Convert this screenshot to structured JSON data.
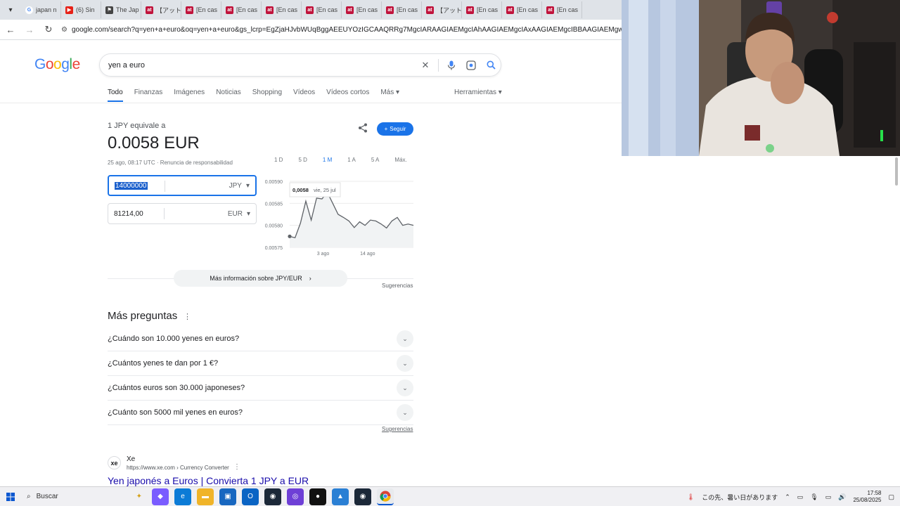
{
  "browser": {
    "tabs": [
      {
        "label": "japan n",
        "icon": "google-icon"
      },
      {
        "label": "(6) Sin",
        "icon": "youtube-icon"
      },
      {
        "label": "The Jap",
        "icon": "site-icon"
      },
      {
        "label": "【アット",
        "icon": "at-icon"
      },
      {
        "label": "[En cas",
        "icon": "at-icon"
      },
      {
        "label": "[En cas",
        "icon": "at-icon"
      },
      {
        "label": "[En cas",
        "icon": "at-icon"
      },
      {
        "label": "[En cas",
        "icon": "at-icon"
      },
      {
        "label": "[En cas",
        "icon": "at-icon"
      },
      {
        "label": "[En cas",
        "icon": "at-icon"
      },
      {
        "label": "【アット",
        "icon": "at-icon"
      },
      {
        "label": "[En cas",
        "icon": "at-icon"
      },
      {
        "label": "[En cas",
        "icon": "at-icon"
      },
      {
        "label": "[En cas",
        "icon": "at-icon"
      }
    ],
    "url": "google.com/search?q=yen+a+euro&oq=yen+a+euro&gs_lcrp=EgZjaHJvbWUqBggAEEUYOzIGCAAQRRg7MgcIARAAGIAEMgcIAhAAGIAEMgcIAxAAGIAEMgcIBBAAGIAEMgwIBRAAGBQYhwI"
  },
  "google": {
    "logo": "Google",
    "query": "yen a euro",
    "tabs": [
      "Todo",
      "Finanzas",
      "Imágenes",
      "Noticias",
      "Shopping",
      "Vídeos",
      "Vídeos cortos",
      "Más"
    ],
    "tools": "Herramientas"
  },
  "converter": {
    "label": "1 JPY equivale a",
    "value": "0.0058 EUR",
    "date": "25 ago, 08:17 UTC · Renuncia de responsabilidad",
    "follow": "Seguir",
    "ranges": [
      "1 D",
      "5 D",
      "1 M",
      "1 A",
      "5 A",
      "Máx."
    ],
    "active_range": "1 M",
    "from_value": "14000000",
    "from_currency": "JPY",
    "to_value": "81214,00",
    "to_currency": "EUR",
    "more_info": "Más información sobre JPY/EUR",
    "suggestions": "Sugerencias"
  },
  "chart_data": {
    "type": "line",
    "ytick_labels": [
      "0.00590",
      "0.00585",
      "0.00580",
      "0.00575"
    ],
    "xtick_labels": [
      "3 ago",
      "14 ago"
    ],
    "ylim": [
      0.00575,
      0.0059
    ],
    "grid": true,
    "tooltip": {
      "value": "0,0058",
      "date": "vie, 25 jul"
    },
    "series": [
      {
        "color": "#5f6368",
        "x": [
          0,
          1,
          2,
          3,
          4,
          5,
          6,
          7,
          8,
          9,
          10,
          11,
          12,
          13,
          14,
          15,
          16,
          17,
          18,
          19,
          20,
          21,
          22,
          23
        ],
        "values": [
          0.005775,
          0.005772,
          0.005805,
          0.005855,
          0.005812,
          0.005862,
          0.00586,
          0.005875,
          0.00585,
          0.005825,
          0.005818,
          0.00581,
          0.005795,
          0.005808,
          0.0058,
          0.005812,
          0.00581,
          0.005803,
          0.005794,
          0.00581,
          0.005818,
          0.0058,
          0.005803,
          0.0058
        ]
      }
    ]
  },
  "paa": {
    "title": "Más preguntas",
    "questions": [
      "¿Cuándo son 10.000 yenes en euros?",
      "¿Cuántos yenes te dan por 1 €?",
      "¿Cuántos euros son 30.000 japoneses?",
      "¿Cuánto son 5000 mil yenes en euros?"
    ],
    "suggestions": "Sugerencias"
  },
  "result": {
    "favicon": "xe",
    "site": "Xe",
    "url": "https://www.xe.com › Currency Converter",
    "title": "Yen japonés a Euros | Convierta 1 JPY a EUR"
  },
  "taskbar": {
    "search": "Buscar",
    "notification": "この先、暑い日があります",
    "time": "17:58",
    "date": "25/08/2025"
  }
}
